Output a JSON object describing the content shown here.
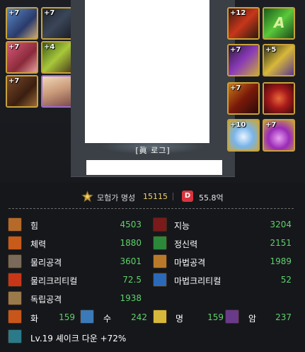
{
  "character": {
    "name": "[眞 로그]"
  },
  "equipment": {
    "left": [
      {
        "level": "+7",
        "icon": "weapon-icon",
        "color": "#3d6ea8"
      },
      {
        "level": "+7",
        "icon": "top-armor-icon",
        "color": "#2b3340"
      },
      {
        "level": "+7",
        "icon": "bottom-armor-icon",
        "color": "#b8475c"
      },
      {
        "level": "+4",
        "icon": "shoulder-icon",
        "color": "#6a8a2a"
      },
      {
        "level": "+7",
        "icon": "shoes-icon",
        "color": "#6a3a1a"
      },
      {
        "level": "",
        "icon": "character-portrait-icon",
        "color": "#d9b08a"
      }
    ],
    "right": [
      {
        "level": "+12",
        "icon": "weapon-right-icon",
        "color": "#6a2a1a"
      },
      {
        "level": "",
        "icon": "title-icon",
        "color": "#2f8a2f"
      },
      {
        "level": "+7",
        "icon": "bracelet-icon",
        "color": "#5a2a6a"
      },
      {
        "level": "+5",
        "icon": "necklace-icon",
        "color": "#8a6a2a"
      },
      {
        "level": "+7",
        "icon": "ring-icon",
        "color": "#7a2a1a"
      },
      {
        "level": "",
        "icon": "sub-equipment-icon",
        "color": "#8a1a1a"
      },
      {
        "level": "+10",
        "icon": "magic-stone-icon",
        "color": "#3a5a8a"
      },
      {
        "level": "+7",
        "icon": "earring-icon",
        "color": "#7a2a8a"
      }
    ]
  },
  "fame": {
    "label": "모험가 명성",
    "value": "15115",
    "d_badge": "D",
    "d_value": "55.8억"
  },
  "stats": {
    "left": [
      {
        "label": "힘",
        "value": "4503",
        "icon": "strength-icon",
        "color": "#b56a2a"
      },
      {
        "label": "체력",
        "value": "1880",
        "icon": "vitality-icon",
        "color": "#c85a1a"
      },
      {
        "label": "물리공격",
        "value": "3601",
        "icon": "physical-attack-icon",
        "color": "#7a6a5a"
      },
      {
        "label": "물리크리티컬",
        "value": "72.5",
        "icon": "physical-critical-icon",
        "color": "#c8361a"
      },
      {
        "label": "독립공격",
        "value": "1938",
        "icon": "independent-attack-icon",
        "color": "#9a7a4a"
      }
    ],
    "right": [
      {
        "label": "지능",
        "value": "3204",
        "icon": "intelligence-icon",
        "color": "#7a1a1a"
      },
      {
        "label": "정신력",
        "value": "2151",
        "icon": "spirit-icon",
        "color": "#2a8a3a"
      },
      {
        "label": "마법공격",
        "value": "1989",
        "icon": "magic-attack-icon",
        "color": "#b87a2a"
      },
      {
        "label": "마법크리티컬",
        "value": "52",
        "icon": "magic-critical-icon",
        "color": "#2a6ab8"
      }
    ]
  },
  "elements": [
    {
      "label": "화",
      "value": "159",
      "icon": "fire-element-icon",
      "color": "#c8561a"
    },
    {
      "label": "수",
      "value": "242",
      "icon": "water-element-icon",
      "color": "#3a7ab8"
    },
    {
      "label": "명",
      "value": "159",
      "icon": "light-element-icon",
      "color": "#d8b83a"
    },
    {
      "label": "암",
      "value": "237",
      "icon": "dark-element-icon",
      "color": "#6a3a8a"
    }
  ],
  "buff": {
    "text": "Lv.19 셰이크 다운 +72%",
    "icon": "shake-down-icon",
    "color": "#2a7a8a"
  }
}
